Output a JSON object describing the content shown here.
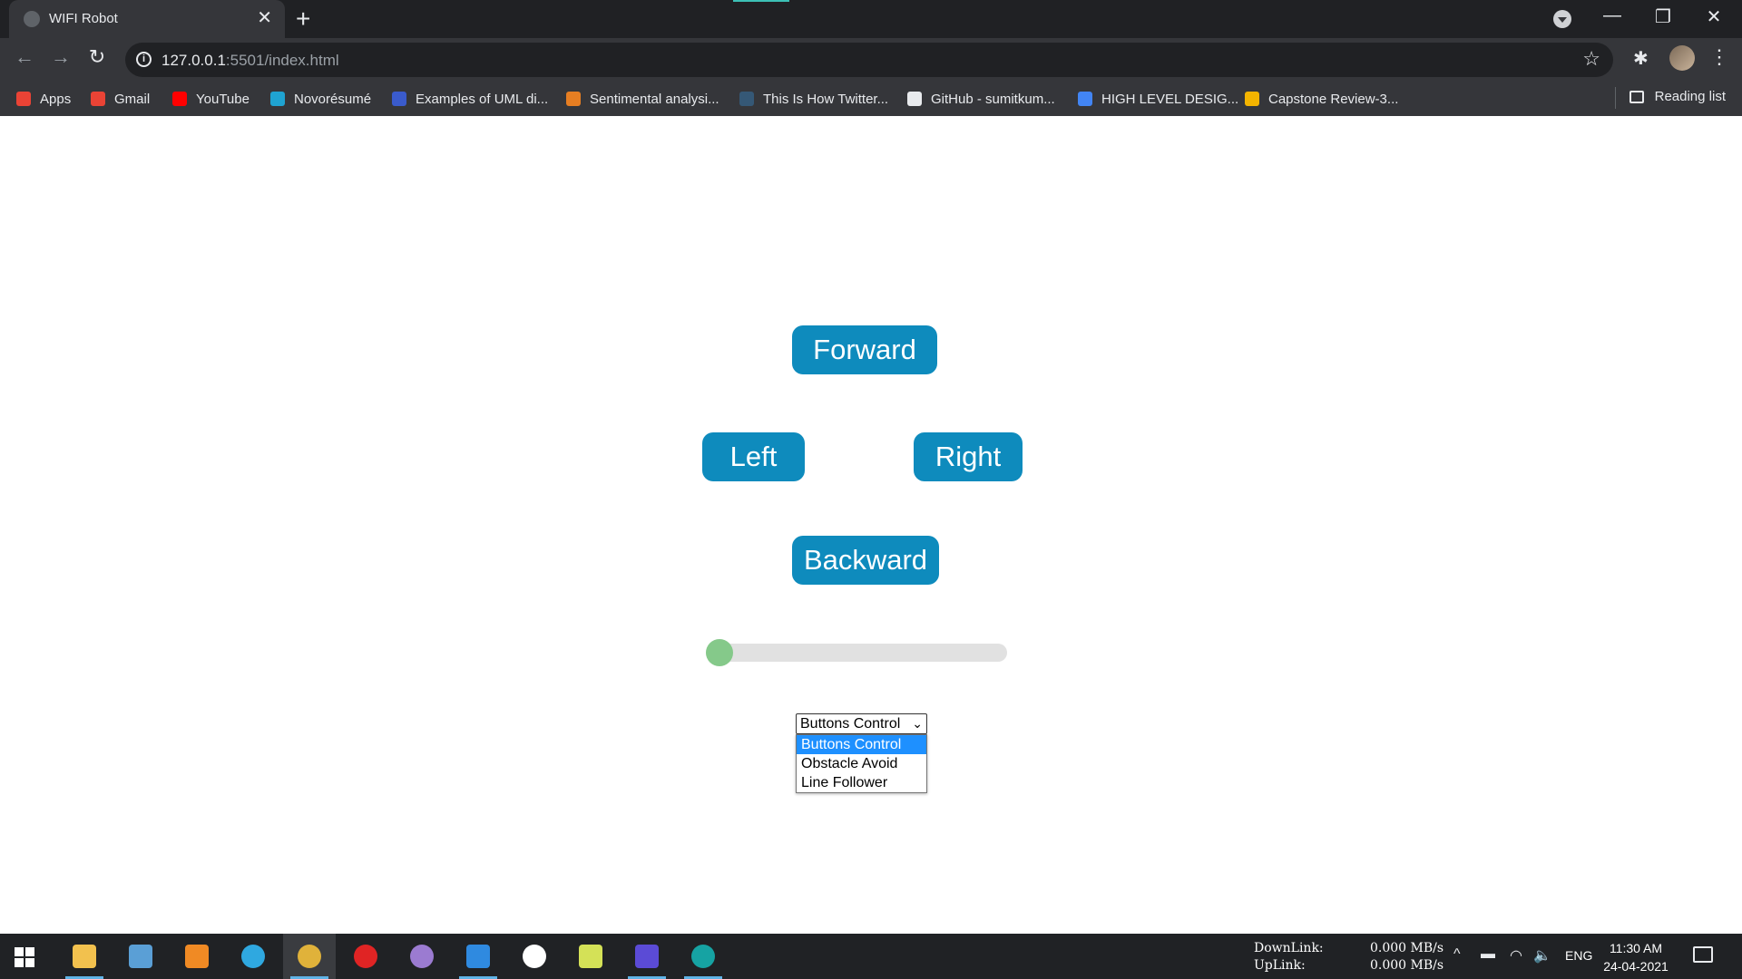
{
  "browser": {
    "tab_title": "WIFI Robot",
    "tab_close": "✕",
    "new_tab": "+",
    "url_host": "127.0.0.1",
    "url_rest": ":5501/index.html",
    "window_controls": {
      "minimize": "—",
      "maximize": "❐",
      "close": "✕"
    },
    "nav": {
      "back": "←",
      "forward": "→",
      "reload": "↻"
    },
    "star": "☆",
    "extensions": "✱",
    "menu": "⋮",
    "bookmarks": [
      {
        "label": "Apps",
        "icon": "apps-grid-icon",
        "color": "#ea4335"
      },
      {
        "label": "Gmail",
        "icon": "gmail-icon",
        "color": "#ea4335"
      },
      {
        "label": "YouTube",
        "icon": "youtube-icon",
        "color": "#ff0000"
      },
      {
        "label": "Novorésumé",
        "icon": "novoresume-icon",
        "color": "#1fa3d1"
      },
      {
        "label": "Examples of UML di...",
        "icon": "uml-icon",
        "color": "#3a5bcc"
      },
      {
        "label": "Sentimental analysi...",
        "icon": "book-icon",
        "color": "#e67e22"
      },
      {
        "label": "This Is How Twitter...",
        "icon": "tds-icon",
        "color": "#355876"
      },
      {
        "label": "GitHub - sumitkum...",
        "icon": "github-icon",
        "color": "#e8eaed"
      },
      {
        "label": "HIGH LEVEL DESIG...",
        "icon": "docs-icon",
        "color": "#4285f4"
      },
      {
        "label": "Capstone Review-3...",
        "icon": "slides-icon",
        "color": "#f4b400"
      }
    ],
    "reading_list": "Reading list"
  },
  "page": {
    "buttons": {
      "forward": "Forward",
      "left": "Left",
      "right": "Right",
      "backward": "Backward"
    },
    "speed_slider": {
      "value_fraction": 0.0
    },
    "mode_select": {
      "selected": "Buttons Control",
      "chevron": "⌄",
      "options": [
        "Buttons Control",
        "Obstacle Avoid",
        "Line Follower"
      ],
      "highlighted_index": 0
    },
    "colors": {
      "button_bg": "#0e8bbd",
      "slider_thumb": "#85c98a",
      "option_highlight": "#1e90ff"
    }
  },
  "taskbar": {
    "apps": [
      {
        "name": "file-explorer-icon",
        "color": "#f2c14e",
        "running": true
      },
      {
        "name": "outlook-icon",
        "color": "#5a9fd6",
        "running": false
      },
      {
        "name": "vlc-icon",
        "color": "#f08a24",
        "running": false
      },
      {
        "name": "edge-icon",
        "color": "#2fa8e0",
        "running": false
      },
      {
        "name": "chrome-icon",
        "color": "#e0b23a",
        "running": true,
        "active": true
      },
      {
        "name": "opera-icon",
        "color": "#e02424",
        "running": false
      },
      {
        "name": "tor-icon",
        "color": "#9b7bd1",
        "running": false
      },
      {
        "name": "vscode-icon",
        "color": "#2f8ae0",
        "running": true
      },
      {
        "name": "app-w-icon",
        "color": "#ffffff",
        "running": false
      },
      {
        "name": "pycharm-icon",
        "color": "#d4e157",
        "running": false
      },
      {
        "name": "intellij-icon",
        "color": "#5b4bd6",
        "running": true
      },
      {
        "name": "arduino-icon",
        "color": "#16a3a3",
        "running": true
      }
    ],
    "net": {
      "down_label": "DownLink:",
      "up_label": "UpLink:",
      "down_value": "0.000 MB/s",
      "up_value": "0.000 MB/s"
    },
    "tray": {
      "chevron": "^",
      "battery": "▬",
      "wifi": "◠",
      "volume": "🔈"
    },
    "lang": "ENG",
    "time": "11:30 AM",
    "date": "24-04-2021"
  }
}
